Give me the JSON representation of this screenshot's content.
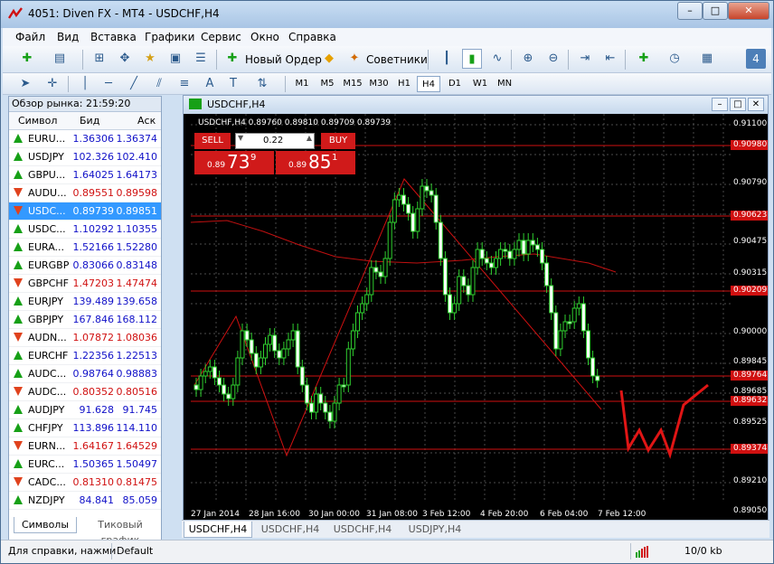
{
  "window": {
    "title": "4051: Diven FX - MT4 - USDCHF,H4",
    "controls": [
      "–",
      "□",
      "✕"
    ]
  },
  "menu": [
    "Файл",
    "Вид",
    "Вставка",
    "Графики",
    "Сервис",
    "Окно",
    "Справка"
  ],
  "toolbar": {
    "new_order": "Новый Ордер",
    "experts": "Советники",
    "badge": "4"
  },
  "timeframes": [
    "M1",
    "M5",
    "M15",
    "M30",
    "H1",
    "H4",
    "D1",
    "W1",
    "MN"
  ],
  "active_timeframe": "H4",
  "market_watch": {
    "header": "Обзор рынка: 21:59:20",
    "columns": {
      "symbol": "Символ",
      "bid": "Бид",
      "ask": "Аск"
    },
    "rows": [
      {
        "sym": "EURU...",
        "bid": "1.36306",
        "ask": "1.36374",
        "dir": "up"
      },
      {
        "sym": "USDJPY",
        "bid": "102.326",
        "ask": "102.410",
        "dir": "up"
      },
      {
        "sym": "GBPU...",
        "bid": "1.64025",
        "ask": "1.64173",
        "dir": "up"
      },
      {
        "sym": "AUDU...",
        "bid": "0.89551",
        "ask": "0.89598",
        "dir": "down"
      },
      {
        "sym": "USDC...",
        "bid": "0.89739",
        "ask": "0.89851",
        "dir": "down",
        "selected": true
      },
      {
        "sym": "USDC...",
        "bid": "1.10292",
        "ask": "1.10355",
        "dir": "up"
      },
      {
        "sym": "EURA...",
        "bid": "1.52166",
        "ask": "1.52280",
        "dir": "up"
      },
      {
        "sym": "EURGBP",
        "bid": "0.83066",
        "ask": "0.83148",
        "dir": "up"
      },
      {
        "sym": "GBPCHF",
        "bid": "1.47203",
        "ask": "1.47474",
        "dir": "down"
      },
      {
        "sym": "EURJPY",
        "bid": "139.489",
        "ask": "139.658",
        "dir": "up"
      },
      {
        "sym": "GBPJPY",
        "bid": "167.846",
        "ask": "168.112",
        "dir": "up"
      },
      {
        "sym": "AUDN...",
        "bid": "1.07872",
        "ask": "1.08036",
        "dir": "down"
      },
      {
        "sym": "EURCHF",
        "bid": "1.22356",
        "ask": "1.22513",
        "dir": "up"
      },
      {
        "sym": "AUDC...",
        "bid": "0.98764",
        "ask": "0.98883",
        "dir": "up"
      },
      {
        "sym": "AUDC...",
        "bid": "0.80352",
        "ask": "0.80516",
        "dir": "down"
      },
      {
        "sym": "AUDJPY",
        "bid": "91.628",
        "ask": "91.745",
        "dir": "up"
      },
      {
        "sym": "CHFJPY",
        "bid": "113.896",
        "ask": "114.110",
        "dir": "up"
      },
      {
        "sym": "EURN...",
        "bid": "1.64167",
        "ask": "1.64529",
        "dir": "down"
      },
      {
        "sym": "EURC...",
        "bid": "1.50365",
        "ask": "1.50497",
        "dir": "up"
      },
      {
        "sym": "CADC...",
        "bid": "0.81310",
        "ask": "0.81475",
        "dir": "down"
      },
      {
        "sym": "NZDJPY",
        "bid": "84.841",
        "ask": "85.059",
        "dir": "up"
      }
    ],
    "tabs": [
      "Символы",
      "Тиковый график"
    ]
  },
  "chart": {
    "window_title": "USDCHF,H4",
    "info": "USDCHF,H4  0.89760 0.89810 0.89709 0.89739",
    "sell_label": "SELL",
    "buy_label": "BUY",
    "lot": "0.22",
    "sell_price_small": "0.89",
    "sell_price_big": "73",
    "sell_price_sup": "9",
    "buy_price_small": "0.89",
    "buy_price_big": "85",
    "buy_price_sup": "1",
    "price_labels": [
      "0.91100",
      "0.90790",
      "0.90475",
      "0.90315",
      "0.90000",
      "0.89845",
      "0.89685",
      "0.89525",
      "0.89210",
      "0.89050"
    ],
    "level_tags": [
      "0.90980",
      "0.90623",
      "0.90209",
      "0.89764",
      "0.89632",
      "0.89374"
    ],
    "time_labels": [
      "27 Jan 2014",
      "28 Jan 16:00",
      "30 Jan 00:00",
      "31 Jan 08:00",
      "3 Feb 12:00",
      "4 Feb 20:00",
      "6 Feb 04:00",
      "7 Feb 12:00"
    ],
    "tabs": [
      "USDCHF,H4",
      "USDCHF,H4",
      "USDCHF,H4",
      "USDJPY,H4"
    ]
  },
  "status": {
    "help": "Для справки, нажми",
    "profile": "Default",
    "traffic": "10/0 kb"
  },
  "colors": {
    "up": "#17a017",
    "down": "#e0421d",
    "level": "#d01010",
    "candle": "#2fd02f",
    "select": "#3399ff"
  }
}
